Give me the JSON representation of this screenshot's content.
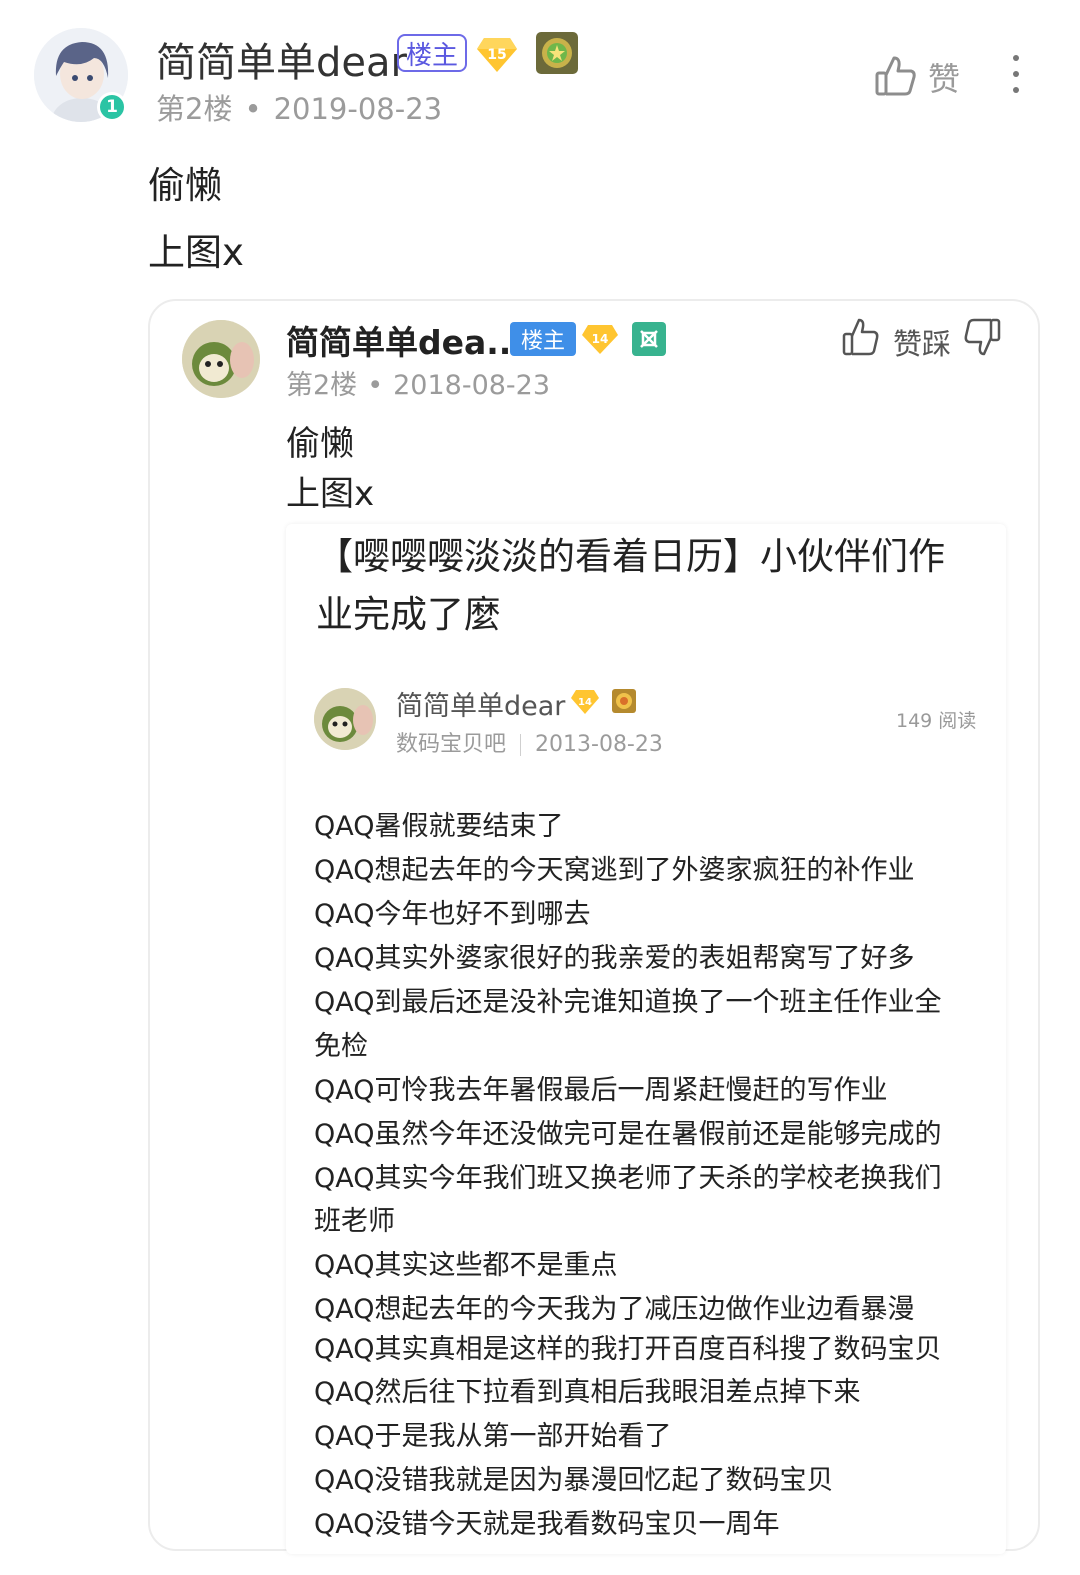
{
  "post": {
    "username": "简简单单dear",
    "owner_badge": "楼主",
    "level_badge": "15",
    "avatar_level": "1",
    "floor": "第2楼",
    "date": "2019-08-23",
    "like_label": "赞",
    "body": [
      "偷懒",
      "上图x"
    ]
  },
  "quoted_post": {
    "username": "简简单单dea...",
    "owner_badge": "楼主",
    "level_badge": "14",
    "floor": "第2楼",
    "date": "2018-08-23",
    "vote_label": "赞踩",
    "body": [
      "偷懒",
      "上图x"
    ]
  },
  "article": {
    "title_lines": [
      "【嘤嘤嘤淡淡的看着日历】小伙伴们作",
      "业完成了麼"
    ],
    "author": "简简单单dear",
    "level_badge": "14",
    "forum": "数码宝贝吧",
    "date": "2013-08-23",
    "reads": "149 阅读",
    "lines": [
      "QAQ暑假就要结束了",
      "QAQ想起去年的今天窝逃到了外婆家疯狂的补作业",
      "QAQ今年也好不到哪去",
      "QAQ其实外婆家很好的我亲爱的表姐帮窝写了好多",
      "QAQ到最后还是没补完谁知道换了一个班主任作业全",
      "免检",
      "QAQ可怜我去年暑假最后一周紧赶慢赶的写作业",
      "QAQ虽然今年还没做完可是在暑假前还是能够完成的",
      "QAQ其实今年我们班又换老师了天杀的学校老换我们",
      "班老师",
      "QAQ其实这些都不是重点",
      "QAQ想起去年的今天我为了减压边做作业边看暴漫",
      "QAQ其实真相是这样的我打开百度百科搜了数码宝贝",
      "QAQ然后往下拉看到真相后我眼泪差点掉下来",
      "QAQ于是我从第一部开始看了",
      "QAQ没错我就是因为暴漫回忆起了数码宝贝",
      "QAQ没错今天就是我看数码宝贝一周年"
    ]
  }
}
